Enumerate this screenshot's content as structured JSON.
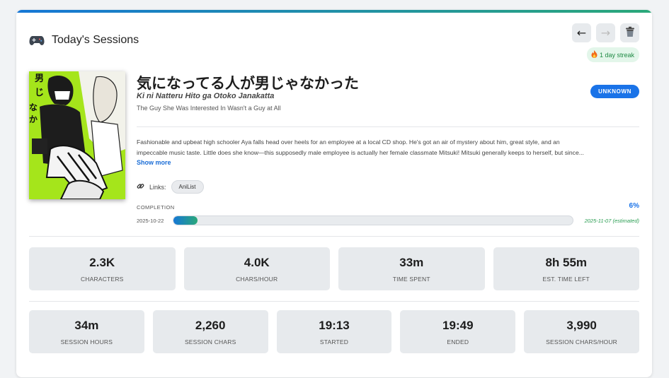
{
  "header": {
    "title": "Today's Sessions",
    "icon": "gamepad-icon",
    "prev_label": "←",
    "next_label": "→",
    "trash_icon": "trash-icon",
    "streak_label": "1 day streak",
    "streak_icon": "fire-icon"
  },
  "book": {
    "title_jp": "気になってる人が男じゃなかった",
    "title_romaji": "Ki ni Natteru Hito ga Otoko Janakatta",
    "title_en": "The Guy She Was Interested In Wasn't a Guy at All",
    "status": "UNKNOWN",
    "description_line1": "Fashionable and upbeat high schooler Aya falls head over heels for an employee at a local CD shop. He's got an air of mystery about him, great style, and an",
    "description_line2": "impeccable music taste. Little does she know—this supposedly male employee is actually her female classmate Mitsuki! Mitsuki generally keeps to herself, but since...",
    "show_more": "Show more",
    "links_label": "Links:",
    "links": [
      "AniList"
    ],
    "cover_title_text": "なかった"
  },
  "completion": {
    "label": "COMPLETION",
    "percent_text": "6%",
    "percent": 6,
    "start_date": "2025-10-22",
    "end_date": "2025-11-07 (estimated)"
  },
  "stats_row1": [
    {
      "value": "2.3K",
      "label": "CHARACTERS"
    },
    {
      "value": "4.0K",
      "label": "CHARS/HOUR"
    },
    {
      "value": "33m",
      "label": "TIME SPENT"
    },
    {
      "value": "8h 55m",
      "label": "EST. TIME LEFT"
    }
  ],
  "stats_row2": [
    {
      "value": "34m",
      "label": "SESSION HOURS"
    },
    {
      "value": "2,260",
      "label": "SESSION CHARS"
    },
    {
      "value": "19:13",
      "label": "STARTED"
    },
    {
      "value": "19:49",
      "label": "ENDED"
    },
    {
      "value": "3,990",
      "label": "SESSION CHARS/HOUR"
    }
  ],
  "colors": {
    "accent": "#1a73e8",
    "success": "#2a9d52",
    "cover_bg": "#a5e51b"
  }
}
